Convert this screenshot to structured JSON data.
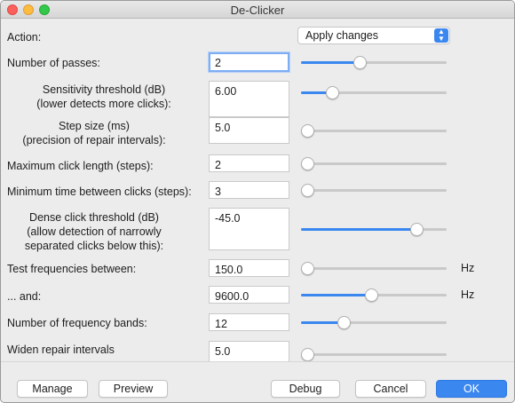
{
  "window": {
    "title": "De-Clicker"
  },
  "action": {
    "label": "Action:",
    "selected": "Apply changes"
  },
  "rows": [
    {
      "label_lines": [
        "Number of passes:"
      ],
      "value": "2",
      "slider": 0.36
    },
    {
      "label_lines": [
        "Sensitivity threshold (dB)",
        "(lower detects more clicks):"
      ],
      "value": "6.00",
      "slider": 0.17
    },
    {
      "label_lines": [
        "Step size (ms)",
        "(precision of repair intervals):"
      ],
      "value": "5.0",
      "slider": 0.0
    },
    {
      "label_lines": [
        "Maximum click length (steps):"
      ],
      "value": "2",
      "slider": 0.0
    },
    {
      "label_lines": [
        "Minimum time between clicks (steps):"
      ],
      "value": "3",
      "slider": 0.0
    },
    {
      "label_lines": [
        "Dense click threshold (dB)",
        "(allow detection of narrowly",
        "separated clicks below this):"
      ],
      "value": "-45.0",
      "slider": 0.75
    },
    {
      "label_lines": [
        "Test frequencies between:"
      ],
      "value": "150.0",
      "slider": 0.0,
      "unit": "Hz"
    },
    {
      "label_lines": [
        "... and:"
      ],
      "value": "9600.0",
      "slider": 0.44,
      "unit": "Hz"
    },
    {
      "label_lines": [
        "Number of frequency bands:"
      ],
      "value": "12",
      "slider": 0.25
    },
    {
      "label_lines": [
        "Widen repair intervals"
      ],
      "value": "5.0",
      "slider": 0.0
    }
  ],
  "buttons": {
    "manage": "Manage",
    "preview": "Preview",
    "debug": "Debug",
    "cancel": "Cancel",
    "ok": "OK"
  },
  "colors": {
    "accent": "#3b87f0"
  }
}
